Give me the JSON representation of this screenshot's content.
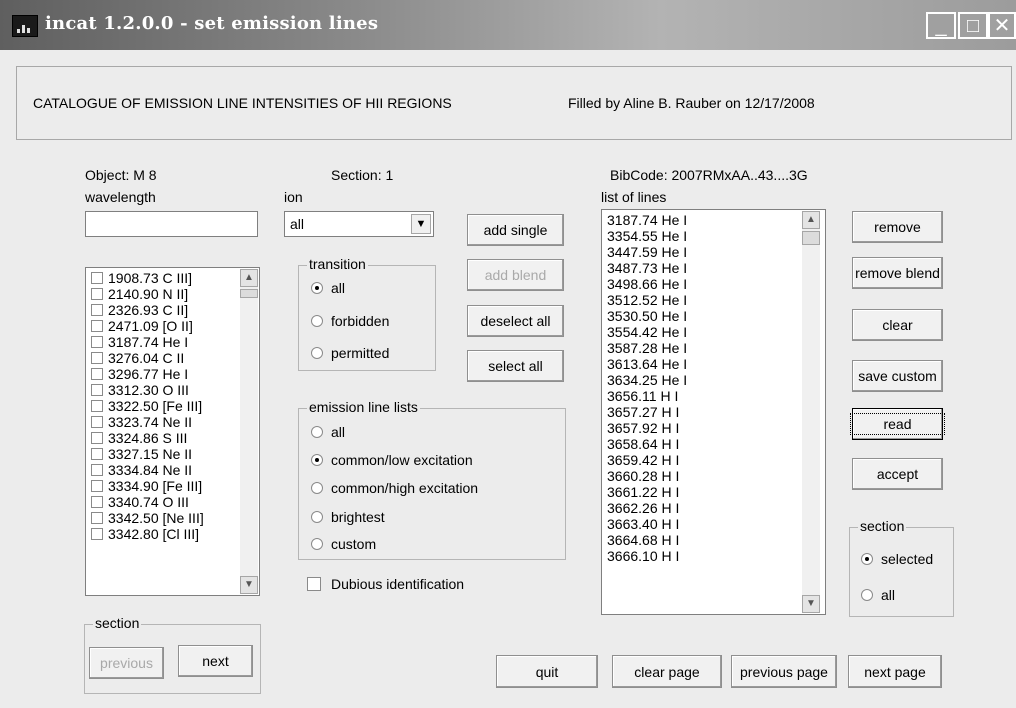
{
  "window": {
    "title": "incat 1.2.0.0 - set emission lines",
    "minimize": "_",
    "maximize": "□",
    "close": "✕"
  },
  "header": {
    "catalogue": "CATALOGUE OF EMISSION LINE INTENSITIES OF HII REGIONS",
    "filled_by": "Filled by Aline B. Rauber on 12/17/2008"
  },
  "info": {
    "object": "Object: M 8",
    "section": "Section: 1",
    "bibcode": "BibCode: 2007RMxAA..43....3G"
  },
  "wavelength": {
    "label": "wavelength",
    "value": ""
  },
  "ion": {
    "label": "ion",
    "value": "all"
  },
  "transition": {
    "label": "transition",
    "options": [
      "all",
      "forbidden",
      "permitted"
    ],
    "selected": "all"
  },
  "emission_lists": {
    "label": "emission line lists",
    "options": [
      "all",
      "common/low excitation",
      "common/high excitation",
      "brightest",
      "custom"
    ],
    "selected": "common/low excitation"
  },
  "dubious": {
    "label": "Dubious identification",
    "checked": false
  },
  "lines_available": [
    "1908.73 C III]",
    "2140.90 N II]",
    "2326.93 C II]",
    "2471.09 [O II]",
    "3187.74 He I",
    "3276.04 C II",
    "3296.77 He I",
    "3312.30 O III",
    "3322.50 [Fe III]",
    "3323.74 Ne II",
    "3324.86 S III",
    "3327.15 Ne II",
    "3334.84 Ne II",
    "3334.90 [Fe III]",
    "3340.74 O III",
    "3342.50 [Ne III]",
    "3342.80 [Cl III]"
  ],
  "list_of_lines": {
    "label": "list of lines",
    "items": [
      "3187.74 He I",
      "3354.55 He I",
      "3447.59 He I",
      "3487.73 He I",
      "3498.66 He I",
      "3512.52 He I",
      "3530.50 He I",
      "3554.42 He I",
      "3587.28 He I",
      "3613.64 He I",
      "3634.25 He I",
      "3656.11 H I",
      "3657.27 H I",
      "3657.92 H I",
      "3658.64 H I",
      "3659.42 H I",
      "3660.28 H I",
      "3661.22 H I",
      "3662.26 H I",
      "3663.40 H I",
      "3664.68 H I",
      "3666.10 H I"
    ]
  },
  "buttons": {
    "add_single": "add single",
    "add_blend": "add blend",
    "deselect_all": "deselect all",
    "select_all": "select all",
    "remove": "remove",
    "remove_blend": "remove blend",
    "clear": "clear",
    "save_custom": "save custom",
    "read": "read",
    "accept": "accept",
    "previous": "previous",
    "next": "next",
    "quit": "quit",
    "clear_page": "clear page",
    "previous_page": "previous page",
    "next_page": "next page"
  },
  "section_left": {
    "label": "section"
  },
  "section_right": {
    "label": "section",
    "options": [
      "selected",
      "all"
    ],
    "selected": "selected"
  },
  "icons": {
    "dropdown": "▼",
    "scroll_up": "▲",
    "scroll_down": "▼"
  }
}
